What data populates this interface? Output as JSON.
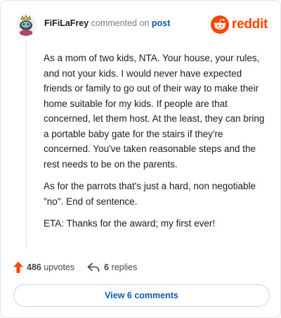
{
  "header": {
    "username": "FiFiLaFrey",
    "commented_text": "commented on",
    "post_link": "post",
    "brand": "reddit"
  },
  "comment": {
    "paragraphs": [
      "As a mom of two kids, NTA. Your house, your rules, and not your kids. I would never have expected friends or family to go out of their way to make their home suitable for my kids. If people are that concerned, let them host. At the least, they can bring a portable baby gate for the stairs if they're concerned. You've taken reasonable steps and the rest needs to be on the parents.",
      "As for the parrots that's just a hard, non negotiable \"no\". End of sentence.",
      "ETA: Thanks for the award; my first ever!"
    ]
  },
  "actions": {
    "upvote_count": "486",
    "upvote_label": "upvotes",
    "reply_count": "6",
    "reply_label": "replies"
  },
  "view_comments_label": "View 6 comments",
  "colors": {
    "brand": "#ff4500",
    "link": "#0a5bb0",
    "upvote": "#ff4500"
  },
  "icons": [
    "avatar",
    "reddit-logo-icon",
    "upvote-arrow-icon",
    "reply-arrow-icon"
  ]
}
